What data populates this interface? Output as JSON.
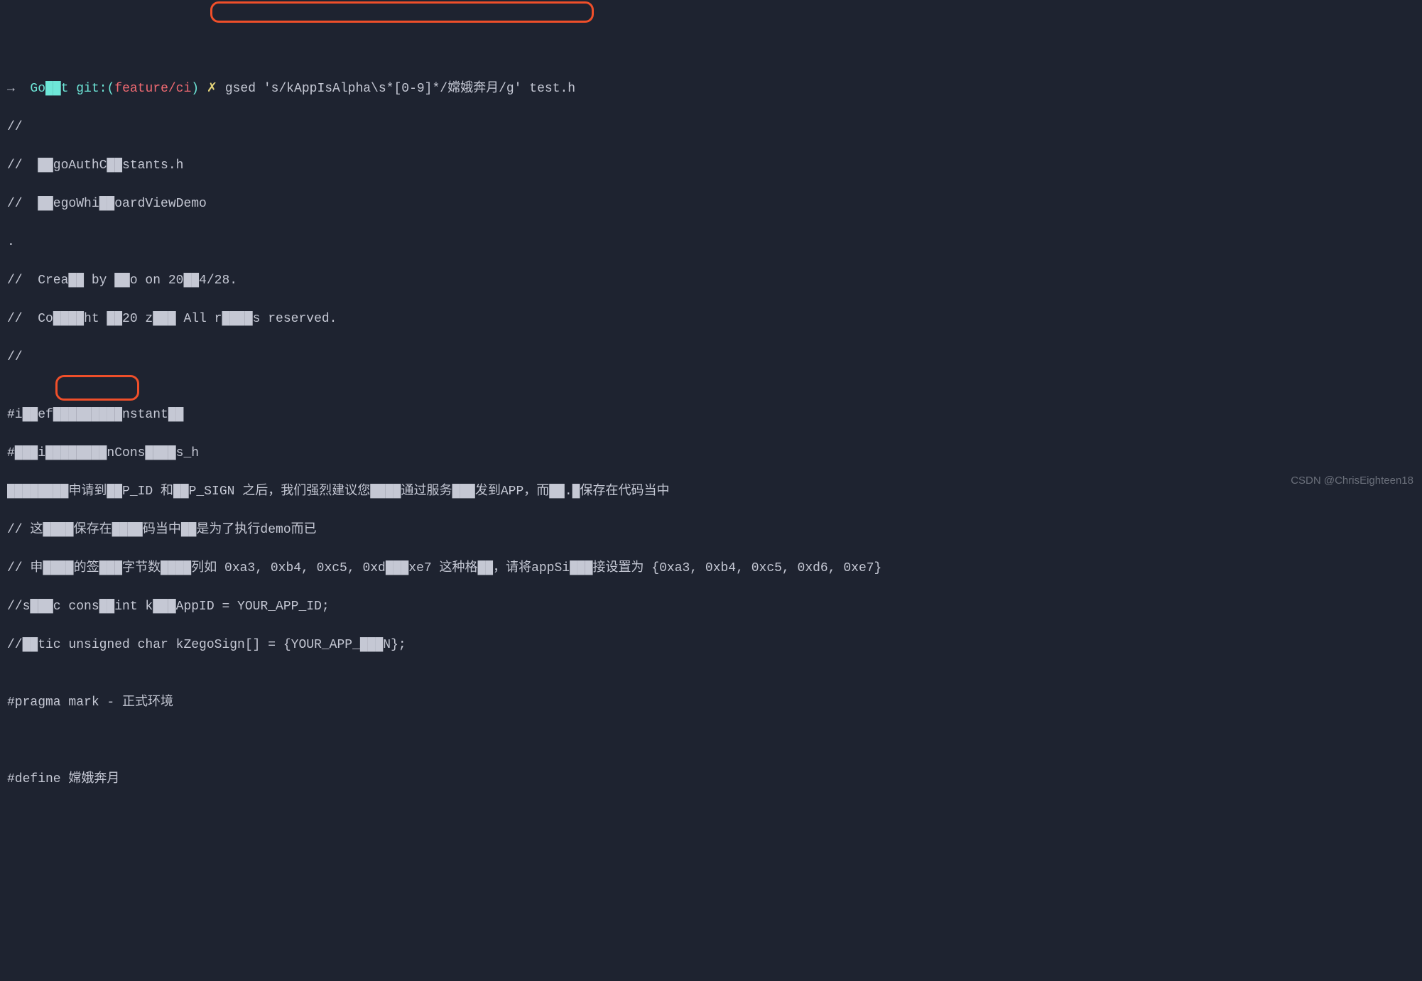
{
  "prompt": {
    "arrow": "→",
    "dir": "Go██t",
    "git_label": "git:(",
    "branch": "feature/ci",
    "git_close": ")",
    "sep": "✗",
    "command": "gsed 's/kAppIsAlpha\\s*[0-9]*/嫦娥奔月/g' test.h"
  },
  "lines": [
    "//",
    "//  ██goAuthC██stants.h",
    "//  ██egoWhi██oardViewDemo",
    ".",
    "//  Crea██ by ██o on 20██4/28.",
    "//  Co████ht ██20 z███ All r████s reserved.",
    "//",
    "",
    "#i██ef█████████nstant██",
    "#███i████████nCons████s_h",
    "████████申请到██P_ID 和██P_SIGN 之后，我们强烈建议您████通过服务███发到APP，而██.█保存在代码当中",
    "// 这████保存在████码当中██是为了执行demo而已",
    "// 申████的签███字节数████列如 0xa3, 0xb4, 0xc5, 0xd███xe7 这种格██，请将appSi███接设置为 {0xa3, 0xb4, 0xc5, 0xd6, 0xe7}",
    "//s███c cons██int k███AppID = YOUR_APP_ID;",
    "//██tic unsigned char kZegoSign[] = {YOUR_APP_███N};",
    "",
    "#pragma mark - 正式环境",
    "",
    "",
    "#define 嫦娥奔月"
  ],
  "watermark": "CSDN @ChrisEighteen18"
}
